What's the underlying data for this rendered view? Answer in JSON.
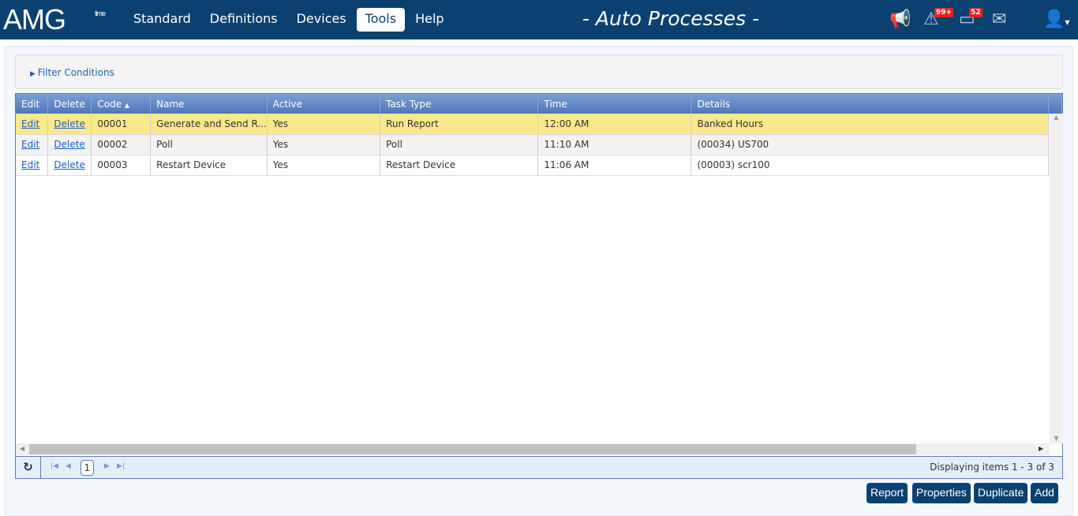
{
  "header": {
    "logo": "AMG",
    "logo_sub": "time",
    "nav": [
      "Standard",
      "Definitions",
      "Devices",
      "Tools",
      "Help"
    ],
    "active_nav": "Tools",
    "title": "- Auto Processes -",
    "alerts_badge": "99+",
    "calendar_badge": "52"
  },
  "filter": {
    "label": "Filter Conditions"
  },
  "grid": {
    "columns": [
      "Edit",
      "Delete",
      "Code",
      "Name",
      "Active",
      "Task Type",
      "Time",
      "Details"
    ],
    "rows": [
      {
        "edit": "Edit",
        "delete": "Delete",
        "code": "00001",
        "name": "Generate and Send R...",
        "active": "Yes",
        "task_type": "Run Report",
        "time": "12:00 AM",
        "details": "Banked Hours"
      },
      {
        "edit": "Edit",
        "delete": "Delete",
        "code": "00002",
        "name": "Poll",
        "active": "Yes",
        "task_type": "Poll",
        "time": "11:10 AM",
        "details": "(00034) US700"
      },
      {
        "edit": "Edit",
        "delete": "Delete",
        "code": "00003",
        "name": "Restart Device",
        "active": "Yes",
        "task_type": "Restart Device",
        "time": "11:06 AM",
        "details": "(00003) scr100"
      }
    ]
  },
  "pager": {
    "page": "1",
    "status": "Displaying items 1 - 3 of 3"
  },
  "buttons": {
    "report": "Report",
    "properties": "Properties",
    "duplicate": "Duplicate",
    "add": "Add"
  }
}
